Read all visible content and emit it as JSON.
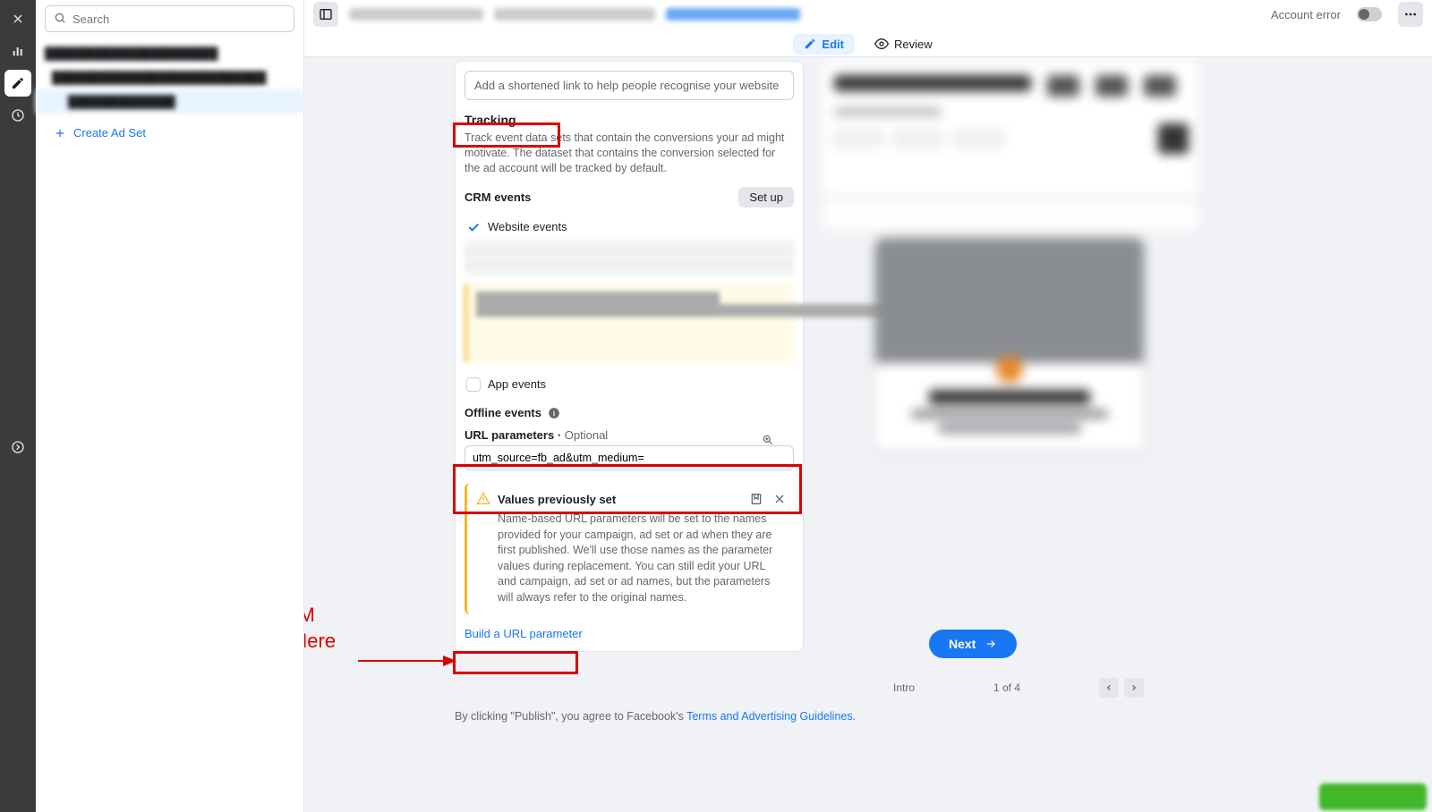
{
  "search": {
    "placeholder": "Search"
  },
  "sidebar": {
    "create_adset": "Create Ad Set"
  },
  "topbar": {
    "account_error": "Account error",
    "edit": "Edit",
    "review": "Review"
  },
  "main": {
    "short_link_placeholder": "Add a shortened link to help people recognise your website",
    "tracking_title": "Tracking",
    "tracking_desc": "Track event data sets that contain the conversions your ad might motivate. The dataset that contains the conversion selected for the ad account will be tracked by default.",
    "crm_events": "CRM events",
    "setup": "Set up",
    "website_events": "Website events",
    "app_events": "App events",
    "offline_events": "Offline events",
    "url_params_label": "URL parameters",
    "optional": "Optional",
    "url_params_value": "utm_source=fb_ad&utm_medium=",
    "warn_title": "Values previously set",
    "warn_body": "Name-based URL parameters will be set to the names provided for your campaign, ad set or ad when they are first published. We'll use those names as the parameter values during replacement. You can still edit your URL and campaign, ad set or ad names, but the parameters will always refer to the original names.",
    "build_link": "Build a URL parameter"
  },
  "annotation": {
    "line1": "Create UTM",
    "line2": "Template Here"
  },
  "preview": {
    "next": "Next",
    "intro": "Intro",
    "page": "1 of 4"
  },
  "footer": {
    "prefix": "By clicking \"Publish\", you agree to Facebook's ",
    "link": "Terms and Advertising Guidelines."
  }
}
